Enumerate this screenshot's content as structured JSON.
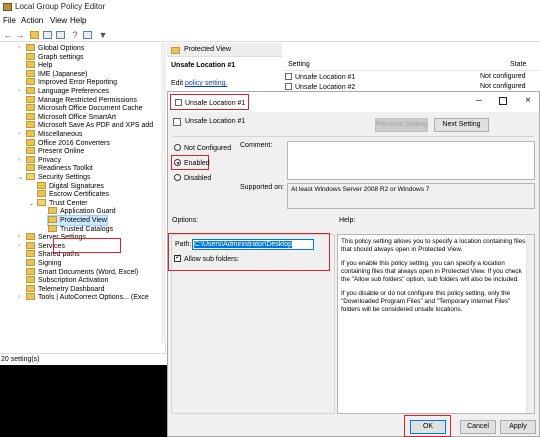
{
  "window": {
    "title": "Local Group Policy Editor",
    "menu": [
      "File",
      "Action",
      "View",
      "Help"
    ]
  },
  "tree": {
    "items": [
      {
        "label": "Global Options",
        "indent": 3,
        "chev": "›"
      },
      {
        "label": "Graph settings",
        "indent": 3
      },
      {
        "label": "Help",
        "indent": 3
      },
      {
        "label": "IME (Japanese)",
        "indent": 3
      },
      {
        "label": "Improved Error Reporting",
        "indent": 3
      },
      {
        "label": "Language Preferences",
        "indent": 3,
        "chev": "›"
      },
      {
        "label": "Manage Restricted Permissions",
        "indent": 3
      },
      {
        "label": "Microsoft Office Document Cache",
        "indent": 3
      },
      {
        "label": "Microsoft Office SmartArt",
        "indent": 3
      },
      {
        "label": "Microsoft Save As PDF and XPS add",
        "indent": 3
      },
      {
        "label": "Miscellaneous",
        "indent": 3,
        "chev": "›"
      },
      {
        "label": "Office 2016 Converters",
        "indent": 3
      },
      {
        "label": "Present Online",
        "indent": 3
      },
      {
        "label": "Privacy",
        "indent": 3,
        "chev": "›"
      },
      {
        "label": "Readiness Toolkit",
        "indent": 3
      },
      {
        "label": "Security Settings",
        "indent": 3,
        "chev": "⌄",
        "open": true
      },
      {
        "label": "Digital Signatures",
        "indent": 4
      },
      {
        "label": "Escrow Certificates",
        "indent": 4
      },
      {
        "label": "Trust Center",
        "indent": 4,
        "chev": "⌄",
        "open": true
      },
      {
        "label": "Application Guard",
        "indent": 5
      },
      {
        "label": "Protected View",
        "indent": 5,
        "selected": true
      },
      {
        "label": "Trusted Catalogs",
        "indent": 5
      },
      {
        "label": "Server Settings",
        "indent": 3,
        "chev": "›"
      },
      {
        "label": "Services",
        "indent": 3,
        "chev": "›"
      },
      {
        "label": "Shared paths",
        "indent": 3
      },
      {
        "label": "Signing",
        "indent": 3
      },
      {
        "label": "Smart Documents (Word, Excel)",
        "indent": 3
      },
      {
        "label": "Subscription Activation",
        "indent": 3
      },
      {
        "label": "Telemetry Dashboard",
        "indent": 3
      },
      {
        "label": "Tools | AutoCorrect Options... (Exce",
        "indent": 3,
        "chev": "›"
      }
    ]
  },
  "status": "20 setting(s)",
  "right_panel": {
    "header": "Protected View",
    "left_title": "Unsafe Location #1",
    "edit_prefix": "Edit ",
    "edit_link": "policy setting.",
    "columns": {
      "setting": "Setting",
      "state": "State"
    },
    "rows": [
      {
        "setting": "Unsafe Location #1",
        "state": "Not configured"
      },
      {
        "setting": "Unsafe Location #2",
        "state": "Not configured"
      }
    ]
  },
  "dialog": {
    "title": "Unsafe Location #1",
    "header_text": "Unsafe Location #1",
    "prev_btn": "Previous Setting",
    "next_btn": "Next Setting",
    "radio_not_configured": "Not Configured",
    "radio_enabled": "Enabled",
    "radio_disabled": "Disabled",
    "comment_label": "Comment:",
    "supported_label": "Supported on:",
    "supported_value": "At least Windows Server 2008 R2 or Windows 7",
    "options_label": "Options:",
    "help_label": "Help:",
    "path_label": "Path:",
    "path_value": "C:\\Users\\Administrator\\Desktop",
    "allow_sub_label": "Allow sub folders:",
    "help_paragraphs": [
      "This policy setting allows you to specify a location containing files that should always open in Protected View.",
      "If you enable this policy setting, you can specify a location containing files that always open in Protected View.  If you check the \"Allow sub folders\" option, sub folders will also be included.",
      "If you disable or do not configure this policy setting, only the \"Downloaded Program Files\" and \"Temporary Internet Files\" folders will be considered unsafe locations."
    ],
    "ok": "OK",
    "cancel": "Cancel",
    "apply": "Apply",
    "selected_state": "Enabled"
  }
}
